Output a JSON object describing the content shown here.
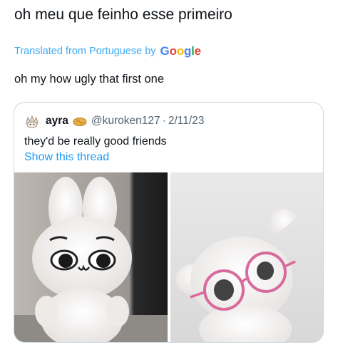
{
  "tweet": {
    "text": "oh meu que feinho esse primeiro",
    "translated_label": "Translated from Portuguese by",
    "translator_logo": "Google",
    "translation": "oh my how ugly that first one"
  },
  "quote": {
    "display_name": "ayra",
    "handle": "@kuroken127",
    "separator": "·",
    "date": "2/11/23",
    "text": "they'd be really good friends",
    "show_thread": "Show this thread"
  },
  "media": [
    {
      "icon": "white-bunny-plush-photo"
    },
    {
      "icon": "white-plush-with-pink-glasses-photo"
    }
  ],
  "colors": {
    "link": "#1d9bf0",
    "secondary_text": "#536471",
    "border": "#cfd9de",
    "primary_text": "#0f1419"
  }
}
